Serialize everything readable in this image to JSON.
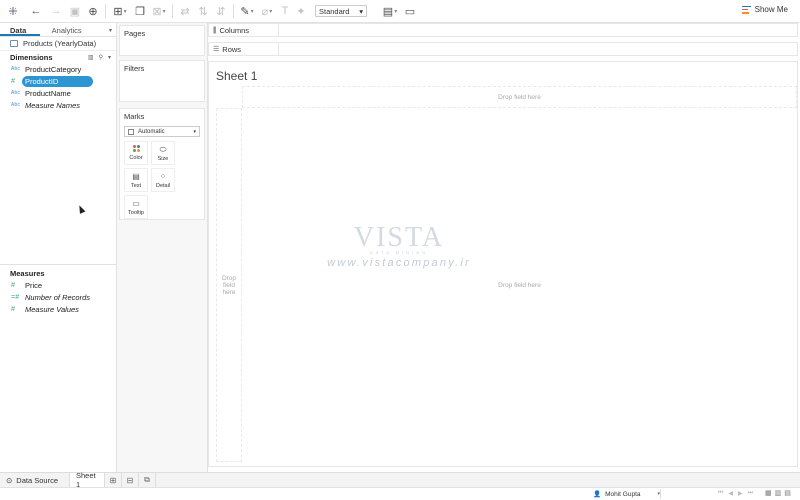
{
  "toolbar": {
    "view_type": "Standard",
    "show_me": "Show Me"
  },
  "data_pane": {
    "tabs": [
      "Data",
      "Analytics"
    ],
    "datasource": "Products (YearlyData)",
    "dimensions_header": "Dimensions",
    "dimensions": [
      {
        "type": "Abc",
        "label": "ProductCategory"
      },
      {
        "type": "#",
        "label": "ProductID"
      },
      {
        "type": "Abc",
        "label": "ProductName"
      },
      {
        "type": "Abc",
        "label": "Measure Names"
      }
    ],
    "measures_header": "Measures",
    "measures": [
      {
        "type": "#",
        "label": "Price"
      },
      {
        "type": "=#",
        "label": "Number of Records"
      },
      {
        "type": "#",
        "label": "Measure Values"
      }
    ]
  },
  "cards": {
    "pages": "Pages",
    "filters": "Filters",
    "marks": "Marks",
    "marks_type": "Automatic",
    "mark_buttons": [
      "Color",
      "Size",
      "Text",
      "Detail",
      "Tooltip"
    ]
  },
  "shelves": {
    "columns": "Columns",
    "rows": "Rows"
  },
  "view": {
    "title": "Sheet 1",
    "drop_top": "Drop field here",
    "drop_left": "Drop field here",
    "drop_main": "Drop field here",
    "watermark_logo": "VISTA",
    "watermark_sub": "DATA MINING",
    "watermark_url": "www.vistacompany.ir"
  },
  "bottom_tabs": {
    "data_source": "Data Source",
    "sheet": "Sheet 1"
  },
  "status": {
    "user": "Mohit Gupta"
  }
}
